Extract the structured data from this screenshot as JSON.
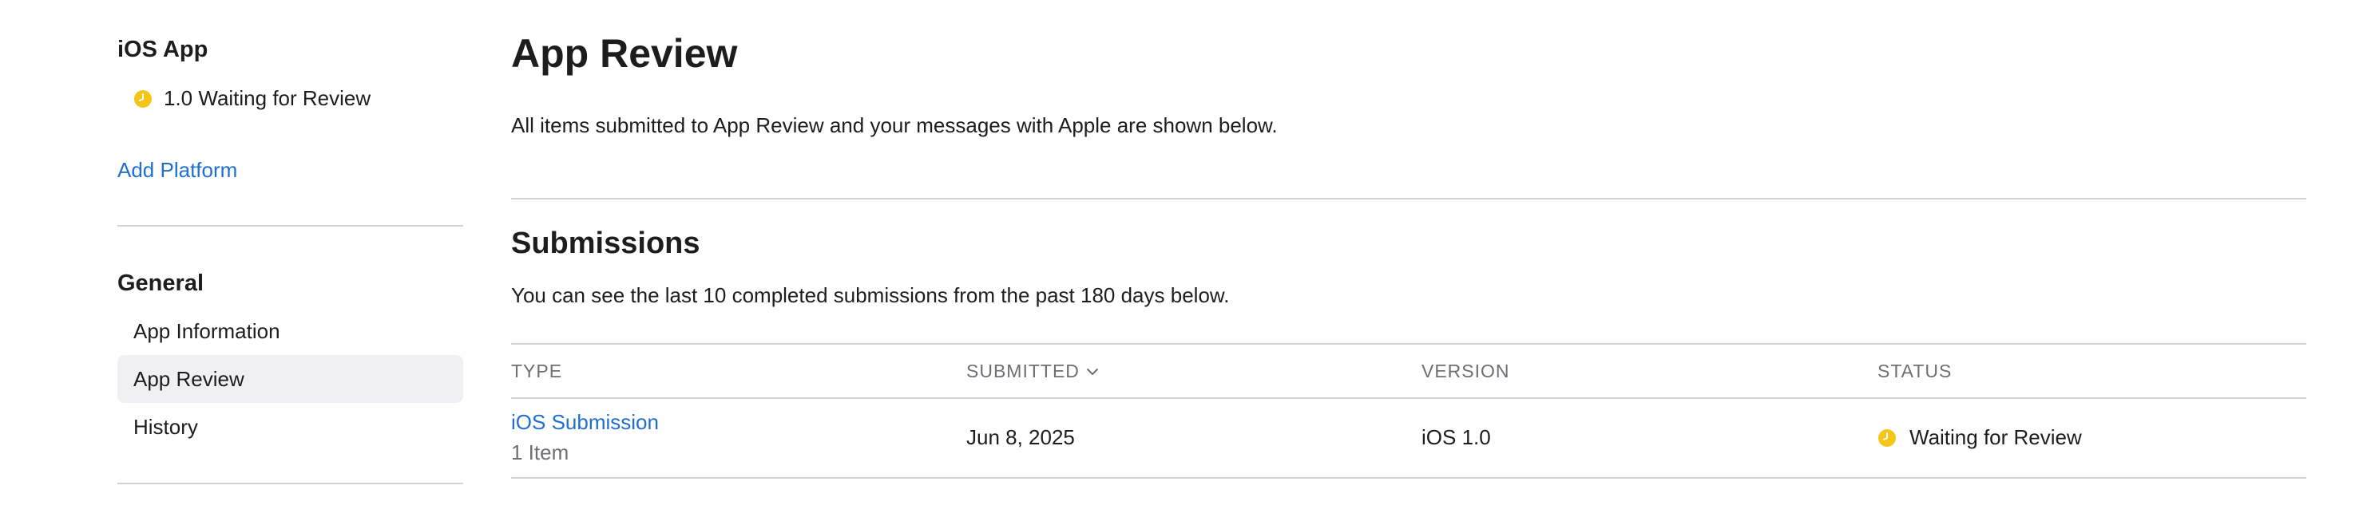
{
  "sidebar": {
    "platform": {
      "title": "iOS App",
      "version_status": "1.0 Waiting for Review",
      "status_icon": "clock-icon",
      "status_color": "#f5c518"
    },
    "add_platform_label": "Add Platform",
    "general": {
      "title": "General",
      "items": [
        {
          "label": "App Information",
          "selected": false
        },
        {
          "label": "App Review",
          "selected": true
        },
        {
          "label": "History",
          "selected": false
        }
      ]
    }
  },
  "main": {
    "title": "App Review",
    "description": "All items submitted to App Review and your messages with Apple are shown below.",
    "submissions": {
      "title": "Submissions",
      "description": "You can see the last 10 completed submissions from the past 180 days below.",
      "columns": {
        "type": "TYPE",
        "submitted": "SUBMITTED",
        "version": "VERSION",
        "status": "STATUS"
      },
      "sort_icon": "chevron-down-icon",
      "rows": [
        {
          "type": "iOS Submission",
          "items": "1 Item",
          "submitted": "Jun 8, 2025",
          "version": "iOS 1.0",
          "status": "Waiting for Review",
          "status_icon": "clock-icon"
        }
      ]
    }
  },
  "colors": {
    "link": "#1f6fd1",
    "status_waiting": "#f5c518",
    "divider": "#d2d2d7",
    "selected_bg": "#f0f0f2"
  }
}
